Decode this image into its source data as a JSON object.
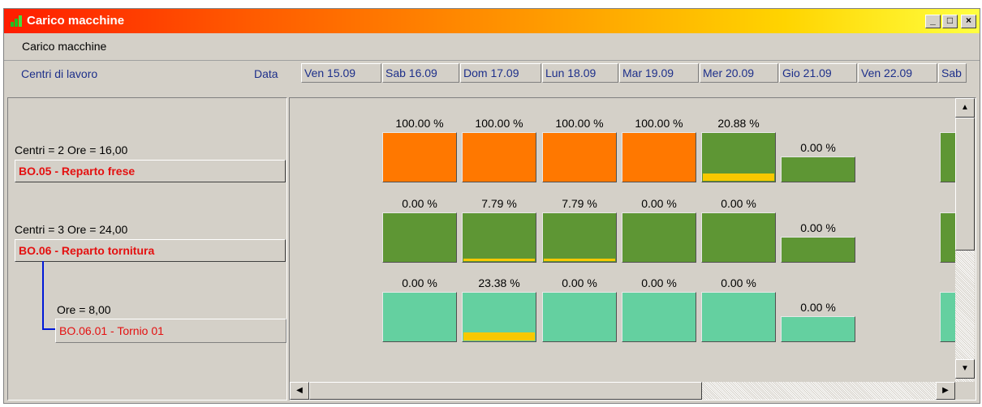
{
  "window": {
    "title": "Carico macchine",
    "minimize": "_",
    "maximize": "□",
    "close": "×"
  },
  "menu": {
    "item": "Carico macchine"
  },
  "header": {
    "work_centers_label": "Centri di lavoro",
    "date_label": "Data"
  },
  "dates": [
    "Ven 15.09",
    "Sab 16.09",
    "Dom 17.09",
    "Lun 18.09",
    "Mar 19.09",
    "Mer 20.09",
    "Gio 21.09",
    "Ven 22.09",
    "Sab"
  ],
  "departments": [
    {
      "info": "Centri = 2 Ore = 16,00",
      "name": "BO.05 - Reparto frese"
    },
    {
      "info": "Centri = 3 Ore = 24,00",
      "name": "BO.06 - Reparto tornitura"
    }
  ],
  "machine": {
    "info": "Ore = 8,00",
    "name": "BO.06.01 - Tornio 01"
  },
  "load_rows": [
    {
      "color": "#ff7800",
      "alt_color": "#5e9634",
      "cells": [
        {
          "pct": "100.00 %",
          "load": 1.0
        },
        {
          "pct": "100.00 %",
          "load": 1.0
        },
        {
          "pct": "100.00 %",
          "load": 1.0
        },
        {
          "pct": "100.00 %",
          "load": 1.0
        },
        {
          "pct": "20.88 %",
          "load": 0.2088
        },
        {
          "pct": "0.00 %",
          "load": 0.0
        }
      ]
    },
    {
      "color": "#5e9634",
      "alt_color": "#5e9634",
      "cells": [
        {
          "pct": "0.00 %",
          "load": 0.0
        },
        {
          "pct": "7.79 %",
          "load": 0.0779
        },
        {
          "pct": "7.79 %",
          "load": 0.0779
        },
        {
          "pct": "0.00 %",
          "load": 0.0
        },
        {
          "pct": "0.00 %",
          "load": 0.0
        },
        {
          "pct": "0.00 %",
          "load": 0.0
        }
      ]
    },
    {
      "color": "#64d0a0",
      "alt_color": "#64d0a0",
      "cells": [
        {
          "pct": "0.00 %",
          "load": 0.0
        },
        {
          "pct": "23.38 %",
          "load": 0.2338
        },
        {
          "pct": "0.00 %",
          "load": 0.0
        },
        {
          "pct": "0.00 %",
          "load": 0.0
        },
        {
          "pct": "0.00 %",
          "load": 0.0
        },
        {
          "pct": "0.00 %",
          "load": 0.0
        }
      ]
    }
  ],
  "colors": {
    "overload": "#ff7800",
    "department_ok": "#5e9634",
    "machine": "#64d0a0",
    "load_fill": "#f8c800",
    "label_red": "#e41010",
    "header_blue": "#1d2f8a"
  },
  "scroll": {
    "up": "▲",
    "down": "▼",
    "left": "◀",
    "right": "▶"
  }
}
